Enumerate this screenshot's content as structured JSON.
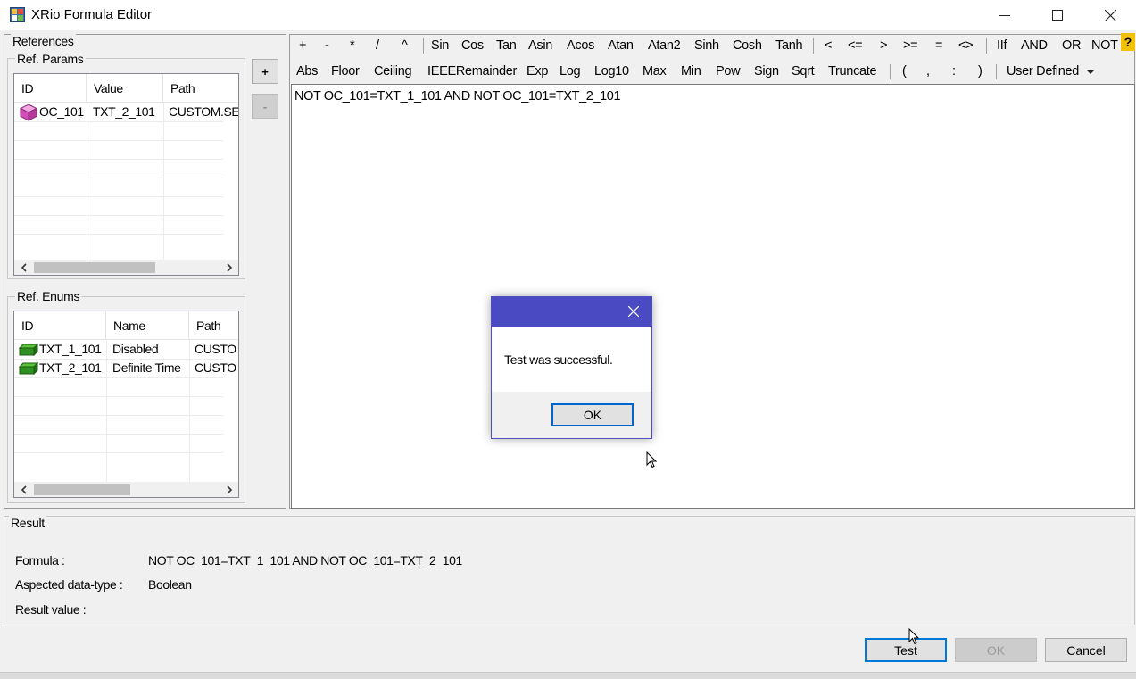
{
  "window": {
    "title": "XRio Formula Editor"
  },
  "references": {
    "group_label": "References",
    "add_label": "+",
    "remove_label": "-"
  },
  "ref_params": {
    "label": "Ref. Params",
    "columns": [
      "ID",
      "Value",
      "Path"
    ],
    "rows": [
      {
        "id": "OC_101",
        "value": "TXT_2_101",
        "path": "CUSTOM.SE",
        "icon": "cube-icon"
      }
    ]
  },
  "ref_enums": {
    "label": "Ref. Enums",
    "columns": [
      "ID",
      "Name",
      "Path"
    ],
    "rows": [
      {
        "id": "TXT_1_101",
        "name": "Disabled",
        "path": "CUSTO",
        "icon": "enum-block-icon"
      },
      {
        "id": "TXT_2_101",
        "name": "Definite Time",
        "path": "CUSTO",
        "icon": "enum-block-icon"
      }
    ]
  },
  "toolbar": {
    "row1": [
      "+",
      "-",
      "*",
      "/",
      "^",
      "Sin",
      "Cos",
      "Tan",
      "Asin",
      "Acos",
      "Atan",
      "Atan2",
      "Sinh",
      "Cosh",
      "Tanh",
      "<",
      "<=",
      ">",
      ">=",
      "=",
      "<>",
      "IIf",
      "AND",
      "OR",
      "NOT"
    ],
    "row2": [
      "Abs",
      "Floor",
      "Ceiling",
      "IEEERemainder",
      "Exp",
      "Log",
      "Log10",
      "Max",
      "Min",
      "Pow",
      "Sign",
      "Sqrt",
      "Truncate",
      "(",
      ",",
      ":",
      ")",
      "User Defined"
    ],
    "help_label": "?"
  },
  "editor": {
    "text": "NOT OC_101=TXT_1_101 AND NOT OC_101=TXT_2_101"
  },
  "result": {
    "group_label": "Result",
    "formula_label": "Formula :",
    "formula_value": "NOT OC_101=TXT_1_101 AND NOT OC_101=TXT_2_101",
    "datatype_label": "Aspected data-type :",
    "datatype_value": "Boolean",
    "result_label": "Result value :",
    "result_value": ""
  },
  "buttons": {
    "test": "Test",
    "ok": "OK",
    "cancel": "Cancel"
  },
  "dialog": {
    "message": "Test was successful.",
    "ok": "OK"
  },
  "colors": {
    "dialog_title": "#4a4ac2",
    "focus_border": "#0078d7",
    "help_icon": "#f2c200"
  }
}
